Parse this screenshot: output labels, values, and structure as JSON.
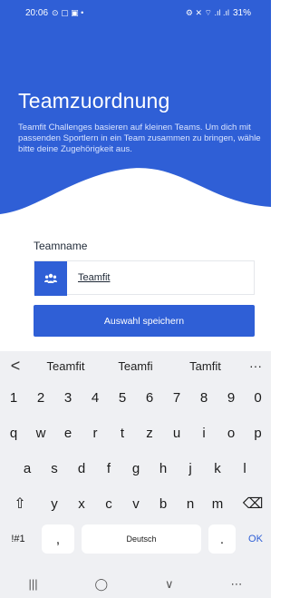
{
  "status": {
    "time": "20:06",
    "left_icons": "⊙ ▢ ▣ •",
    "right_icons": "⚙ ✕ ⌔ .ıl .ıl",
    "battery": "31%"
  },
  "hero": {
    "title": "Teamzuordnung",
    "text": "Teamfit Challenges basieren auf kleinen Teams. Um dich mit passenden Sportlern in ein Team zusammen zu bringen, wähle bitte deine Zugehörigkeit aus."
  },
  "form": {
    "label": "Teamname",
    "value": "Teamfit",
    "save_button": "Auswahl speichern"
  },
  "keyboard": {
    "suggestions": [
      "Teamfit",
      "Teamfi",
      "Tamfit"
    ],
    "back": "<",
    "more": "···",
    "row_numbers": [
      "1",
      "2",
      "3",
      "4",
      "5",
      "6",
      "7",
      "8",
      "9",
      "0"
    ],
    "row_q": [
      "q",
      "w",
      "e",
      "r",
      "t",
      "z",
      "u",
      "i",
      "o",
      "p"
    ],
    "row_a": [
      "a",
      "s",
      "d",
      "f",
      "g",
      "h",
      "j",
      "k",
      "l"
    ],
    "row_y": [
      "y",
      "x",
      "c",
      "v",
      "b",
      "n",
      "m"
    ],
    "shift": "⇧",
    "backspace": "⌫",
    "symbols": "!#1",
    "comma": ",",
    "space": "Deutsch",
    "period": ".",
    "ok": "OK"
  },
  "navbar": {
    "recent": "|||",
    "home": "◯",
    "back": "∨",
    "keyboard": "⋯"
  },
  "colors": {
    "primary": "#2f5fd6",
    "ok": "#2f5fd6"
  }
}
